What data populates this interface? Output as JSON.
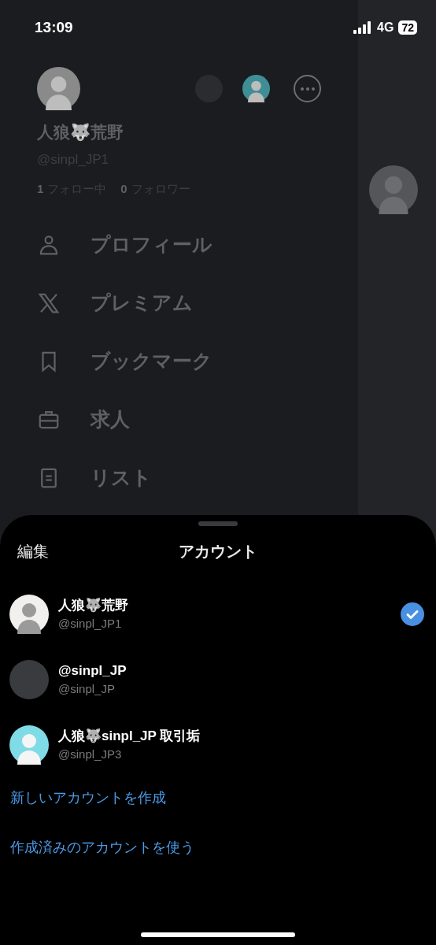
{
  "status_bar": {
    "time": "13:09",
    "network": "4G",
    "battery": "72"
  },
  "drawer": {
    "profile": {
      "name": "人狼🐺荒野",
      "handle": "@sinpl_JP1",
      "following_count": "1",
      "following_label": "フォロー中",
      "followers_count": "0",
      "followers_label": "フォロワー"
    },
    "menu": [
      {
        "label": "プロフィール"
      },
      {
        "label": "プレミアム"
      },
      {
        "label": "ブックマーク"
      },
      {
        "label": "求人"
      },
      {
        "label": "リスト"
      }
    ]
  },
  "sheet": {
    "edit": "編集",
    "title": "アカウント",
    "accounts": [
      {
        "name": "人狼🐺荒野",
        "handle": "@sinpl_JP1",
        "selected": true
      },
      {
        "name": "@sinpl_JP",
        "handle": "@sinpl_JP",
        "selected": false
      },
      {
        "name": "人狼🐺sinpl_JP 取引垢",
        "handle": "@sinpl_JP3",
        "selected": false
      }
    ],
    "actions": [
      "新しいアカウントを作成",
      "作成済みのアカウントを使う"
    ]
  }
}
